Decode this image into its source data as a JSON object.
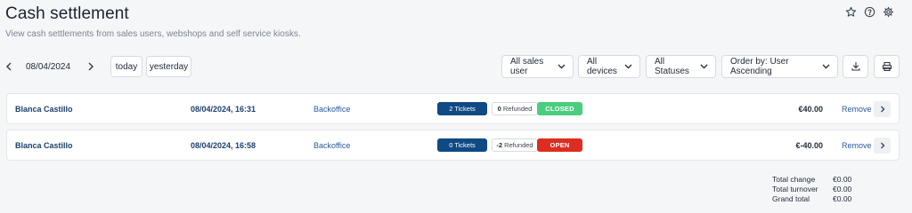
{
  "header": {
    "title": "Cash settlement",
    "subtitle": "View cash settlements from sales users, webshops and self service kiosks."
  },
  "top_icons": [
    "star-icon",
    "help-icon",
    "gear-icon"
  ],
  "date_nav": {
    "date": "08/04/2024",
    "today_label": "today",
    "yesterday_label": "yesterday"
  },
  "filters": {
    "sales_user": "All sales user",
    "devices": "All devices",
    "statuses": "All Statuses",
    "order_by": "Order by: User Ascending"
  },
  "actions": [
    "download-icon",
    "print-icon"
  ],
  "rows": [
    {
      "user": "Blanca Castillo",
      "datetime": "08/04/2024, 16:31",
      "source": "Backoffice",
      "tickets": "2 Tickets",
      "refunded_count": "0",
      "refunded_label": "Refunded",
      "status": "CLOSED",
      "amount": "€40.00",
      "remove_label": "Remove"
    },
    {
      "user": "Blanca Castillo",
      "datetime": "08/04/2024, 16:58",
      "source": "Backoffice",
      "tickets": "0 Tickets",
      "refunded_count": "-2",
      "refunded_label": "Refunded",
      "status": "OPEN",
      "amount": "€-40.00",
      "remove_label": "Remove"
    }
  ],
  "totals": [
    {
      "label": "Total change",
      "value": "€0.00"
    },
    {
      "label": "Total turnover",
      "value": "€0.00"
    },
    {
      "label": "Grand total",
      "value": "€0.00"
    }
  ],
  "colors": {
    "closed": "#4ccc7e",
    "open": "#dd2c20",
    "tickets_badge": "#0f4a84",
    "link": "#2a5a9b"
  }
}
